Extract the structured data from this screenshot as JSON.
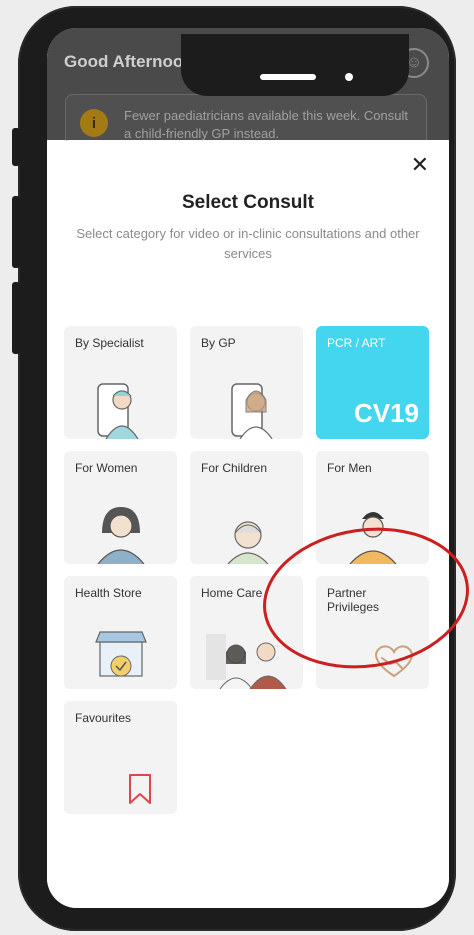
{
  "header": {
    "greeting": "Good Afternoon",
    "notice": "Fewer paediatricians available this week. Consult a child-friendly GP instead."
  },
  "modal": {
    "close": "✕",
    "title": "Select Consult",
    "subtitle": "Select category for video or in-clinic consultations and other services"
  },
  "tiles": [
    {
      "label": "By Specialist",
      "icon": "doctor-specialist-icon"
    },
    {
      "label": "By GP",
      "icon": "doctor-gp-icon"
    },
    {
      "label": "PCR / ART",
      "badge": "CV19",
      "color": "#44d6ef"
    },
    {
      "label": "For Women",
      "icon": "woman-icon"
    },
    {
      "label": "For Children",
      "icon": "child-icon"
    },
    {
      "label": "For Men",
      "icon": "man-icon"
    },
    {
      "label": "Health Store",
      "icon": "store-icon"
    },
    {
      "label": "Home Care",
      "icon": "home-care-icon"
    },
    {
      "label": "Partner\nPrivileges",
      "icon": "handshake-heart-icon"
    },
    {
      "label": "Favourites",
      "icon": "bookmark-icon"
    }
  ],
  "colors": {
    "accent": "#44d6ef",
    "annotation": "#cc1f1f",
    "bookmark": "#e0434b"
  }
}
